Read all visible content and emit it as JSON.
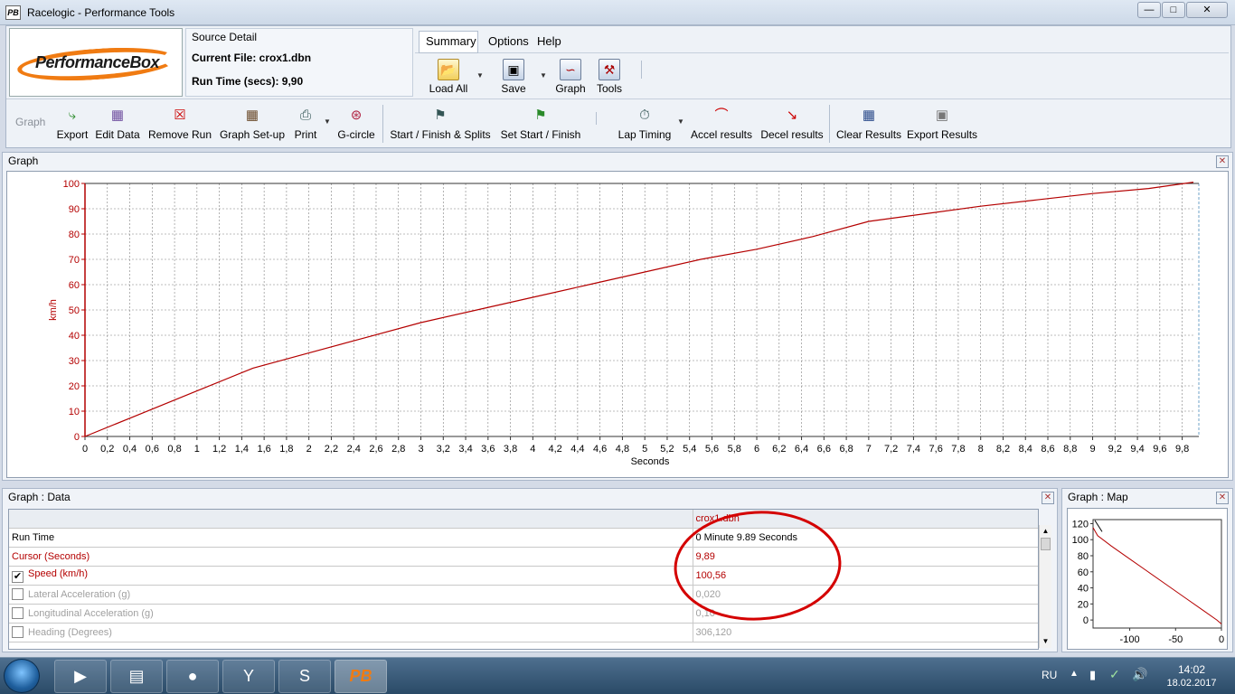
{
  "window": {
    "title": "Racelogic - Performance Tools",
    "icon_text": "PB",
    "min": "—",
    "max": "□",
    "close": "✕"
  },
  "logo": {
    "text": "PerformanceBox"
  },
  "source": {
    "title": "Source Detail",
    "current_file": "Current File: crox1.dbn",
    "run_time": "Run Time (secs): 9,90"
  },
  "menu": {
    "items": [
      "Summary",
      "Options",
      "Help"
    ]
  },
  "top_tools": [
    {
      "label": "Load All",
      "icon": "folder-open-icon"
    },
    {
      "label": "Save",
      "icon": "floppy-icon"
    },
    {
      "label": "Graph",
      "icon": "graph-icon"
    },
    {
      "label": "Tools",
      "icon": "tools-icon"
    }
  ],
  "toolbar": {
    "disabled_label": "Graph",
    "items": [
      {
        "label": "Export",
        "icon": "export-icon"
      },
      {
        "label": "Edit Data",
        "icon": "edit-data-icon"
      },
      {
        "label": "Remove Run",
        "icon": "remove-run-icon"
      },
      {
        "label": "Graph Set-up",
        "icon": "graph-setup-icon"
      },
      {
        "label": "Print",
        "icon": "print-icon"
      },
      {
        "label": "G-circle",
        "icon": "g-circle-icon"
      },
      {
        "label": "Start / Finish & Splits",
        "icon": "checkered-flag-icon"
      },
      {
        "label": "Set Start / Finish",
        "icon": "checkered-flag-add-icon"
      },
      {
        "label": "Lap Timing",
        "icon": "stopwatch-icon"
      },
      {
        "label": "Accel results",
        "icon": "accel-curve-icon"
      },
      {
        "label": "Decel results",
        "icon": "decel-curve-icon"
      },
      {
        "label": "Clear Results",
        "icon": "clear-results-icon"
      },
      {
        "label": "Export Results",
        "icon": "export-results-icon"
      }
    ]
  },
  "graph_panel": {
    "title": "Graph",
    "close": "✕"
  },
  "chart_data": [
    {
      "type": "line",
      "xlabel": "Seconds",
      "ylabel": "km/h",
      "xlim": [
        0,
        9.9
      ],
      "ylim": [
        0,
        100
      ],
      "grid": true,
      "x_ticks": [
        "0",
        "0,2",
        "0,4",
        "0,6",
        "0,8",
        "1",
        "1,2",
        "1,4",
        "1,6",
        "1,8",
        "2",
        "2,2",
        "2,4",
        "2,6",
        "2,8",
        "3",
        "3,2",
        "3,4",
        "3,6",
        "3,8",
        "4",
        "4,2",
        "4,4",
        "4,6",
        "4,8",
        "5",
        "5,2",
        "5,4",
        "5,6",
        "5,8",
        "6",
        "6,2",
        "6,4",
        "6,6",
        "6,8",
        "7",
        "7,2",
        "7,4",
        "7,6",
        "7,8",
        "8",
        "8,2",
        "8,4",
        "8,6",
        "8,8",
        "9",
        "9,2",
        "9,4",
        "9,6",
        "9,8"
      ],
      "y_ticks": [
        "0",
        "10",
        "20",
        "30",
        "40",
        "50",
        "60",
        "70",
        "80",
        "90",
        "100"
      ],
      "series": [
        {
          "color": "#b40000",
          "x": [
            0,
            0.5,
            1,
            1.5,
            2,
            2.5,
            3,
            3.5,
            4,
            4.5,
            5,
            5.5,
            6,
            6.5,
            7,
            7.5,
            8,
            8.5,
            9,
            9.5,
            9.9
          ],
          "y": [
            0,
            9,
            18,
            27,
            33,
            39,
            45,
            50,
            55,
            60,
            65,
            70,
            74,
            79,
            85,
            88,
            91,
            93.5,
            96,
            98,
            100.5
          ]
        }
      ]
    },
    {
      "type": "line",
      "x_ticks": [
        "-100",
        "-50",
        "0"
      ],
      "y_ticks": [
        "0",
        "20",
        "40",
        "60",
        "80",
        "100",
        "120"
      ],
      "xlim": [
        -140,
        0
      ],
      "ylim": [
        -10,
        125
      ],
      "series": [
        {
          "color": "#b40000",
          "x": [
            -140,
            -135,
            -120,
            -100,
            -80,
            -60,
            -40,
            -20,
            -5,
            0
          ],
          "y": [
            115,
            105,
            92,
            76,
            60,
            44,
            28,
            12,
            0,
            -5
          ]
        }
      ]
    }
  ],
  "data_panel": {
    "title": "Graph : Data",
    "close": "✕",
    "column_header": "crox1.dbn",
    "rows": [
      {
        "label": "Run Time",
        "value": "0 Minute 9.89 Seconds",
        "style": "normal",
        "checkbox": false,
        "checked": false
      },
      {
        "label": "Cursor (Seconds)",
        "value": "9,89",
        "style": "red",
        "checkbox": false,
        "checked": false
      },
      {
        "label": "Speed (km/h)",
        "value": "100,56",
        "style": "red",
        "checkbox": true,
        "checked": true
      },
      {
        "label": "Lateral Acceleration (g)",
        "value": "0,020",
        "style": "grey",
        "checkbox": true,
        "checked": false
      },
      {
        "label": "Longitudinal Acceleration (g)",
        "value": "0,10",
        "style": "grey",
        "checkbox": true,
        "checked": false
      },
      {
        "label": "Heading (Degrees)",
        "value": "306,120",
        "style": "grey",
        "checkbox": true,
        "checked": false
      }
    ]
  },
  "map_panel": {
    "title": "Graph : Map",
    "close": "✕"
  },
  "taskbar": {
    "apps": [
      {
        "name": "media-player-icon",
        "glyph": "▶"
      },
      {
        "name": "explorer-icon",
        "glyph": "▤"
      },
      {
        "name": "chrome-icon",
        "glyph": "●"
      },
      {
        "name": "yandex-icon",
        "glyph": "Y"
      },
      {
        "name": "skype-icon",
        "glyph": "S"
      },
      {
        "name": "performancebox-icon",
        "glyph": "PB"
      }
    ],
    "lang": "RU",
    "time": "14:02",
    "date": "18.02.2017"
  },
  "colors": {
    "series": "#b40000",
    "annotation": "#d40000",
    "grid": "#7f7f7f"
  }
}
